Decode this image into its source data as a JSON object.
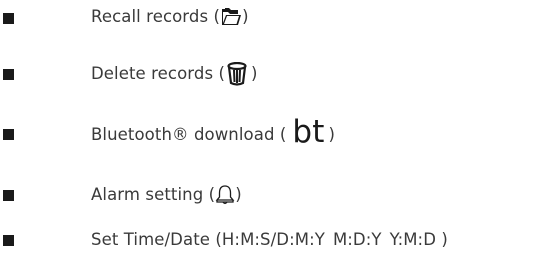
{
  "items": [
    {
      "label": "Recall records (",
      "icon": "folder-open-icon",
      "close": ")"
    },
    {
      "label": "Delete records ( ",
      "icon": "trash-can-icon",
      "close": " )"
    },
    {
      "label": "Bluetooth® download ( ",
      "icon_text": "bt",
      "close": " )"
    },
    {
      "label": "Alarm setting (",
      "icon": "bell-icon",
      "close": " )"
    },
    {
      "label": "Set Time/Date (H:M:S/D:M:Y",
      "part2": "M:D:Y",
      "part3": "Y:M:D )"
    }
  ],
  "colors": {
    "text": "#3a3a3a",
    "bullet": "#1a1a1a",
    "icon": "#1a1a1a"
  }
}
